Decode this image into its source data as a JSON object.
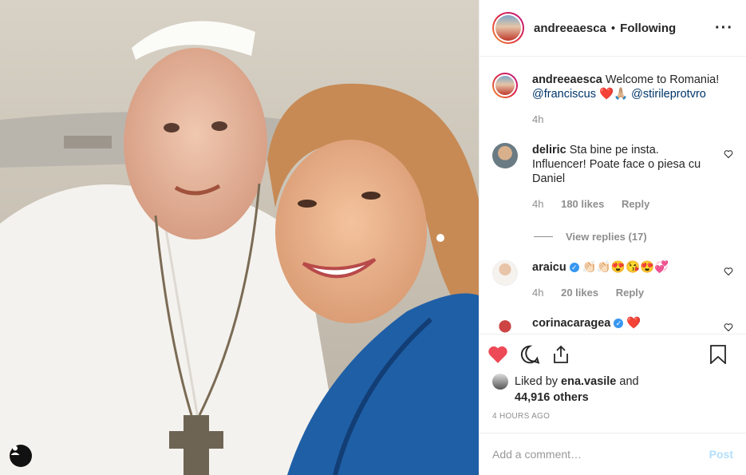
{
  "post": {
    "author": "andreeaesca",
    "separator": "•",
    "follow_status": "Following",
    "more_icon": "more-horizontal-icon",
    "caption_text": "Welcome to Romania!",
    "caption_mention1": "@franciscus",
    "caption_emoji": "❤️🙏🏼",
    "caption_mention2": "@stirileprotvro",
    "caption_time": "4h"
  },
  "comments": [
    {
      "user": "deliric",
      "text": "Sta bine pe insta. Influencer! Poate face o piesa cu Daniel",
      "time": "4h",
      "likes": "180 likes",
      "reply": "Reply",
      "view_replies": "View replies (17)"
    },
    {
      "user": "araicu",
      "text": "👏🏻👏🏻😍😘😍💞",
      "time": "4h",
      "likes": "20 likes",
      "reply": "Reply"
    },
    {
      "user": "corinacaragea",
      "text": "❤️"
    }
  ],
  "liked_by": {
    "prefix": "Liked by",
    "user": "ena.vasile",
    "joiner": "and",
    "others": "44,916 others"
  },
  "timestamp": "4 HOURS AGO",
  "add_comment": {
    "placeholder": "Add a comment…",
    "post_label": "Post"
  },
  "colors": {
    "like_red": "#ed4956",
    "verified_blue": "#3897f0",
    "post_disabled": "#b2dffc"
  }
}
